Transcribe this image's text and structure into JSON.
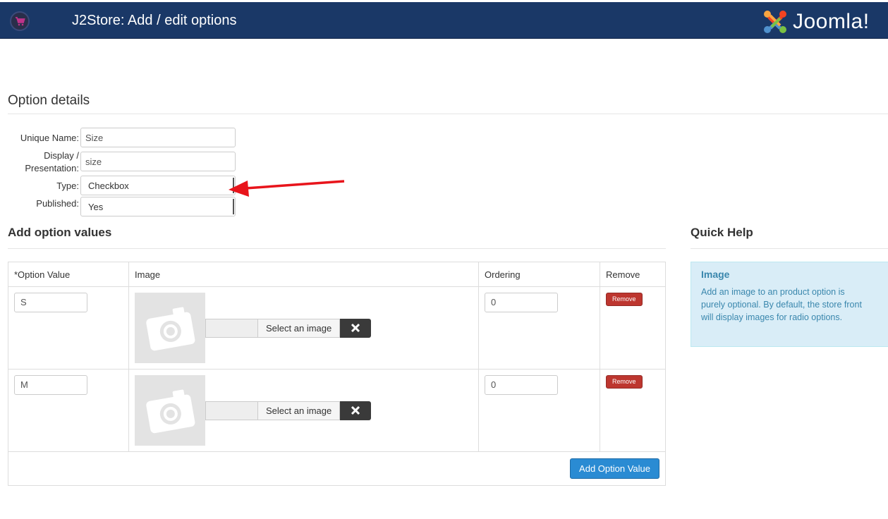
{
  "header": {
    "app_title": "J2Store: Add / edit options",
    "cart_icon": "shopping-cart-icon",
    "brand": "Joomla!",
    "brand_colors": [
      "#f9a541",
      "#f44321",
      "#5091cd",
      "#7ac143"
    ]
  },
  "details": {
    "heading": "Option details",
    "unique_name_label": "Unique Name:",
    "unique_name_value": "Size",
    "display_label_line1": "Display /",
    "display_label_line2": "Presentation:",
    "display_value": "size",
    "type_label": "Type:",
    "type_value": "Checkbox",
    "published_label": "Published:",
    "published_value": "Yes"
  },
  "values_section": {
    "heading": "Add option values",
    "columns": [
      "*Option Value",
      "Image",
      "Ordering",
      "Remove"
    ],
    "rows": [
      {
        "value": "S",
        "ordering": "0",
        "select_label": "Select an image",
        "remove_label": "Remove"
      },
      {
        "value": "M",
        "ordering": "0",
        "select_label": "Select an image",
        "remove_label": "Remove"
      }
    ],
    "add_button": "Add Option Value"
  },
  "help": {
    "heading": "Quick Help",
    "box_title": "Image",
    "box_text": "Add an image to an product option is purely optional. By default, the store front will display images for radio options."
  },
  "colors": {
    "topbar": "#1a3867",
    "remove": "#bd362f",
    "primary": "#2a8bd3",
    "annotation_arrow": "#e8141b"
  }
}
